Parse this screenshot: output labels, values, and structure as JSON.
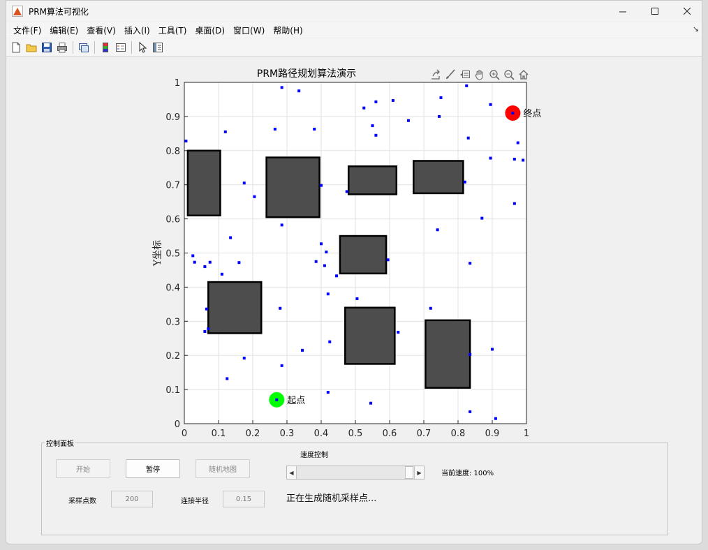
{
  "window": {
    "title": "PRM算法可视化"
  },
  "menu": [
    "文件(F)",
    "编辑(E)",
    "查看(V)",
    "插入(I)",
    "工具(T)",
    "桌面(D)",
    "窗口(W)",
    "帮助(H)"
  ],
  "panel": {
    "title": "控制面板",
    "start_label": "开始",
    "pause_label": "暂停",
    "random_map_label": "随机地图",
    "speed_label": "速度控制",
    "speed_value_label": "当前速度: 100%",
    "speed_fraction": 1.0,
    "samples_label": "采样点数",
    "samples_value": "200",
    "radius_label": "连接半径",
    "radius_value": "0.15",
    "status": "正在生成随机采样点..."
  },
  "colors": {
    "obstacle": "#4d4d4d",
    "sample": "#0000ff",
    "start": "#00ff00",
    "goal": "#ff0000"
  },
  "chart_data": {
    "type": "scatter",
    "title": "PRM路径规划算法演示",
    "xlabel": "",
    "ylabel": "Y坐标",
    "xlim": [
      0,
      1
    ],
    "ylim": [
      0,
      1
    ],
    "xticks": [
      "0",
      "0.1",
      "0.2",
      "0.3",
      "0.4",
      "0.5",
      "0.6",
      "0.7",
      "0.8",
      "0.9",
      "1"
    ],
    "yticks": [
      "0",
      "0.1",
      "0.2",
      "0.3",
      "0.4",
      "0.5",
      "0.6",
      "0.7",
      "0.8",
      "0.9",
      "1"
    ],
    "grid": true,
    "obstacles": [
      {
        "x": [
          0.01,
          0.105
        ],
        "y": [
          0.61,
          0.8
        ]
      },
      {
        "x": [
          0.24,
          0.395
        ],
        "y": [
          0.605,
          0.78
        ]
      },
      {
        "x": [
          0.48,
          0.62
        ],
        "y": [
          0.672,
          0.754
        ]
      },
      {
        "x": [
          0.67,
          0.815
        ],
        "y": [
          0.675,
          0.77
        ]
      },
      {
        "x": [
          0.455,
          0.59
        ],
        "y": [
          0.44,
          0.55
        ]
      },
      {
        "x": [
          0.07,
          0.225
        ],
        "y": [
          0.265,
          0.415
        ]
      },
      {
        "x": [
          0.47,
          0.615
        ],
        "y": [
          0.175,
          0.34
        ]
      },
      {
        "x": [
          0.705,
          0.835
        ],
        "y": [
          0.105,
          0.303
        ]
      }
    ],
    "samples": [
      [
        0.285,
        0.985
      ],
      [
        0.335,
        0.975
      ],
      [
        0.825,
        0.99
      ],
      [
        0.005,
        0.828
      ],
      [
        0.12,
        0.855
      ],
      [
        0.265,
        0.863
      ],
      [
        0.38,
        0.863
      ],
      [
        0.525,
        0.925
      ],
      [
        0.56,
        0.943
      ],
      [
        0.61,
        0.947
      ],
      [
        0.55,
        0.873
      ],
      [
        0.56,
        0.845
      ],
      [
        0.655,
        0.888
      ],
      [
        0.75,
        0.955
      ],
      [
        0.745,
        0.9
      ],
      [
        0.895,
        0.935
      ],
      [
        0.83,
        0.837
      ],
      [
        0.975,
        0.823
      ],
      [
        0.895,
        0.778
      ],
      [
        0.965,
        0.775
      ],
      [
        0.99,
        0.772
      ],
      [
        0.175,
        0.705
      ],
      [
        0.205,
        0.665
      ],
      [
        0.4,
        0.698
      ],
      [
        0.475,
        0.68
      ],
      [
        0.82,
        0.708
      ],
      [
        0.965,
        0.645
      ],
      [
        0.87,
        0.602
      ],
      [
        0.285,
        0.582
      ],
      [
        0.74,
        0.568
      ],
      [
        0.135,
        0.545
      ],
      [
        0.025,
        0.492
      ],
      [
        0.03,
        0.473
      ],
      [
        0.075,
        0.473
      ],
      [
        0.16,
        0.472
      ],
      [
        0.06,
        0.46
      ],
      [
        0.11,
        0.438
      ],
      [
        0.4,
        0.527
      ],
      [
        0.415,
        0.503
      ],
      [
        0.385,
        0.475
      ],
      [
        0.41,
        0.463
      ],
      [
        0.445,
        0.433
      ],
      [
        0.595,
        0.48
      ],
      [
        0.835,
        0.47
      ],
      [
        0.42,
        0.38
      ],
      [
        0.505,
        0.366
      ],
      [
        0.065,
        0.336
      ],
      [
        0.28,
        0.338
      ],
      [
        0.72,
        0.338
      ],
      [
        0.07,
        0.278
      ],
      [
        0.06,
        0.27
      ],
      [
        0.625,
        0.268
      ],
      [
        0.425,
        0.24
      ],
      [
        0.345,
        0.215
      ],
      [
        0.9,
        0.218
      ],
      [
        0.835,
        0.203
      ],
      [
        0.175,
        0.192
      ],
      [
        0.285,
        0.17
      ],
      [
        0.125,
        0.132
      ],
      [
        0.42,
        0.092
      ],
      [
        0.545,
        0.06
      ],
      [
        0.835,
        0.035
      ],
      [
        0.91,
        0.015
      ]
    ],
    "start": {
      "x": 0.27,
      "y": 0.07,
      "label": "起点"
    },
    "goal": {
      "x": 0.96,
      "y": 0.91,
      "label": "终点"
    }
  }
}
